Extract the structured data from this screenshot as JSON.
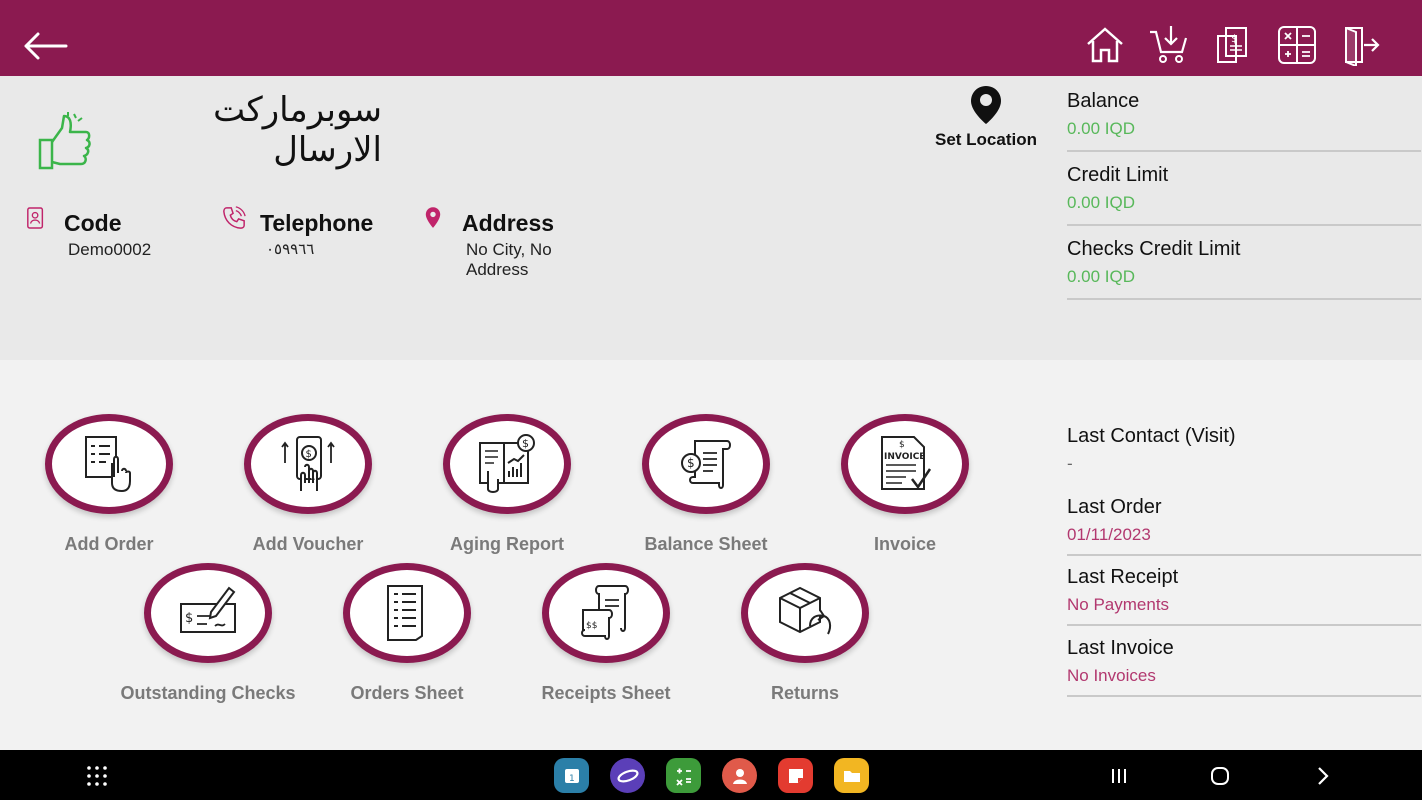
{
  "header": {
    "back_icon": "back-arrow-icon",
    "icons": [
      "home-icon",
      "cart-download-icon",
      "receipt-dollar-icon",
      "calculator-icon",
      "exit-icon"
    ]
  },
  "customer": {
    "name": "سوبرماركت الارسال",
    "set_location_label": "Set Location",
    "code_label": "Code",
    "code_value": "Demo0002",
    "telephone_label": "Telephone",
    "telephone_value": "٠٥٩٩٦٦",
    "address_label": "Address",
    "address_value": "No City, No Address"
  },
  "account": {
    "balance_label": "Balance",
    "balance_value": "0.00 IQD",
    "credit_limit_label": "Credit Limit",
    "credit_limit_value": "0.00 IQD",
    "checks_credit_limit_label": "Checks Credit Limit",
    "checks_credit_limit_value": "0.00 IQD"
  },
  "history": {
    "last_contact_label": "Last Contact (Visit)",
    "last_contact_value": "-",
    "last_order_label": "Last Order",
    "last_order_value": "01/11/2023",
    "last_receipt_label": "Last Receipt",
    "last_receipt_value": "No Payments",
    "last_invoice_label": "Last Invoice",
    "last_invoice_value": "No Invoices"
  },
  "actions": [
    {
      "label": "Add Order",
      "icon": "order-list-icon"
    },
    {
      "label": "Add Voucher",
      "icon": "mobile-payment-icon"
    },
    {
      "label": "Aging Report",
      "icon": "report-chart-icon"
    },
    {
      "label": "Balance Sheet",
      "icon": "ledger-scroll-icon"
    },
    {
      "label": "Invoice",
      "icon": "invoice-icon"
    },
    {
      "label": "Outstanding Checks",
      "icon": "check-signing-icon"
    },
    {
      "label": "Orders Sheet",
      "icon": "orders-document-icon"
    },
    {
      "label": "Receipts  Sheet",
      "icon": "receipts-scroll-icon"
    },
    {
      "label": "Returns",
      "icon": "return-box-icon"
    }
  ],
  "colors": {
    "brand": "#8b1a50",
    "green": "#58b85a",
    "pink": "#b2386f"
  }
}
